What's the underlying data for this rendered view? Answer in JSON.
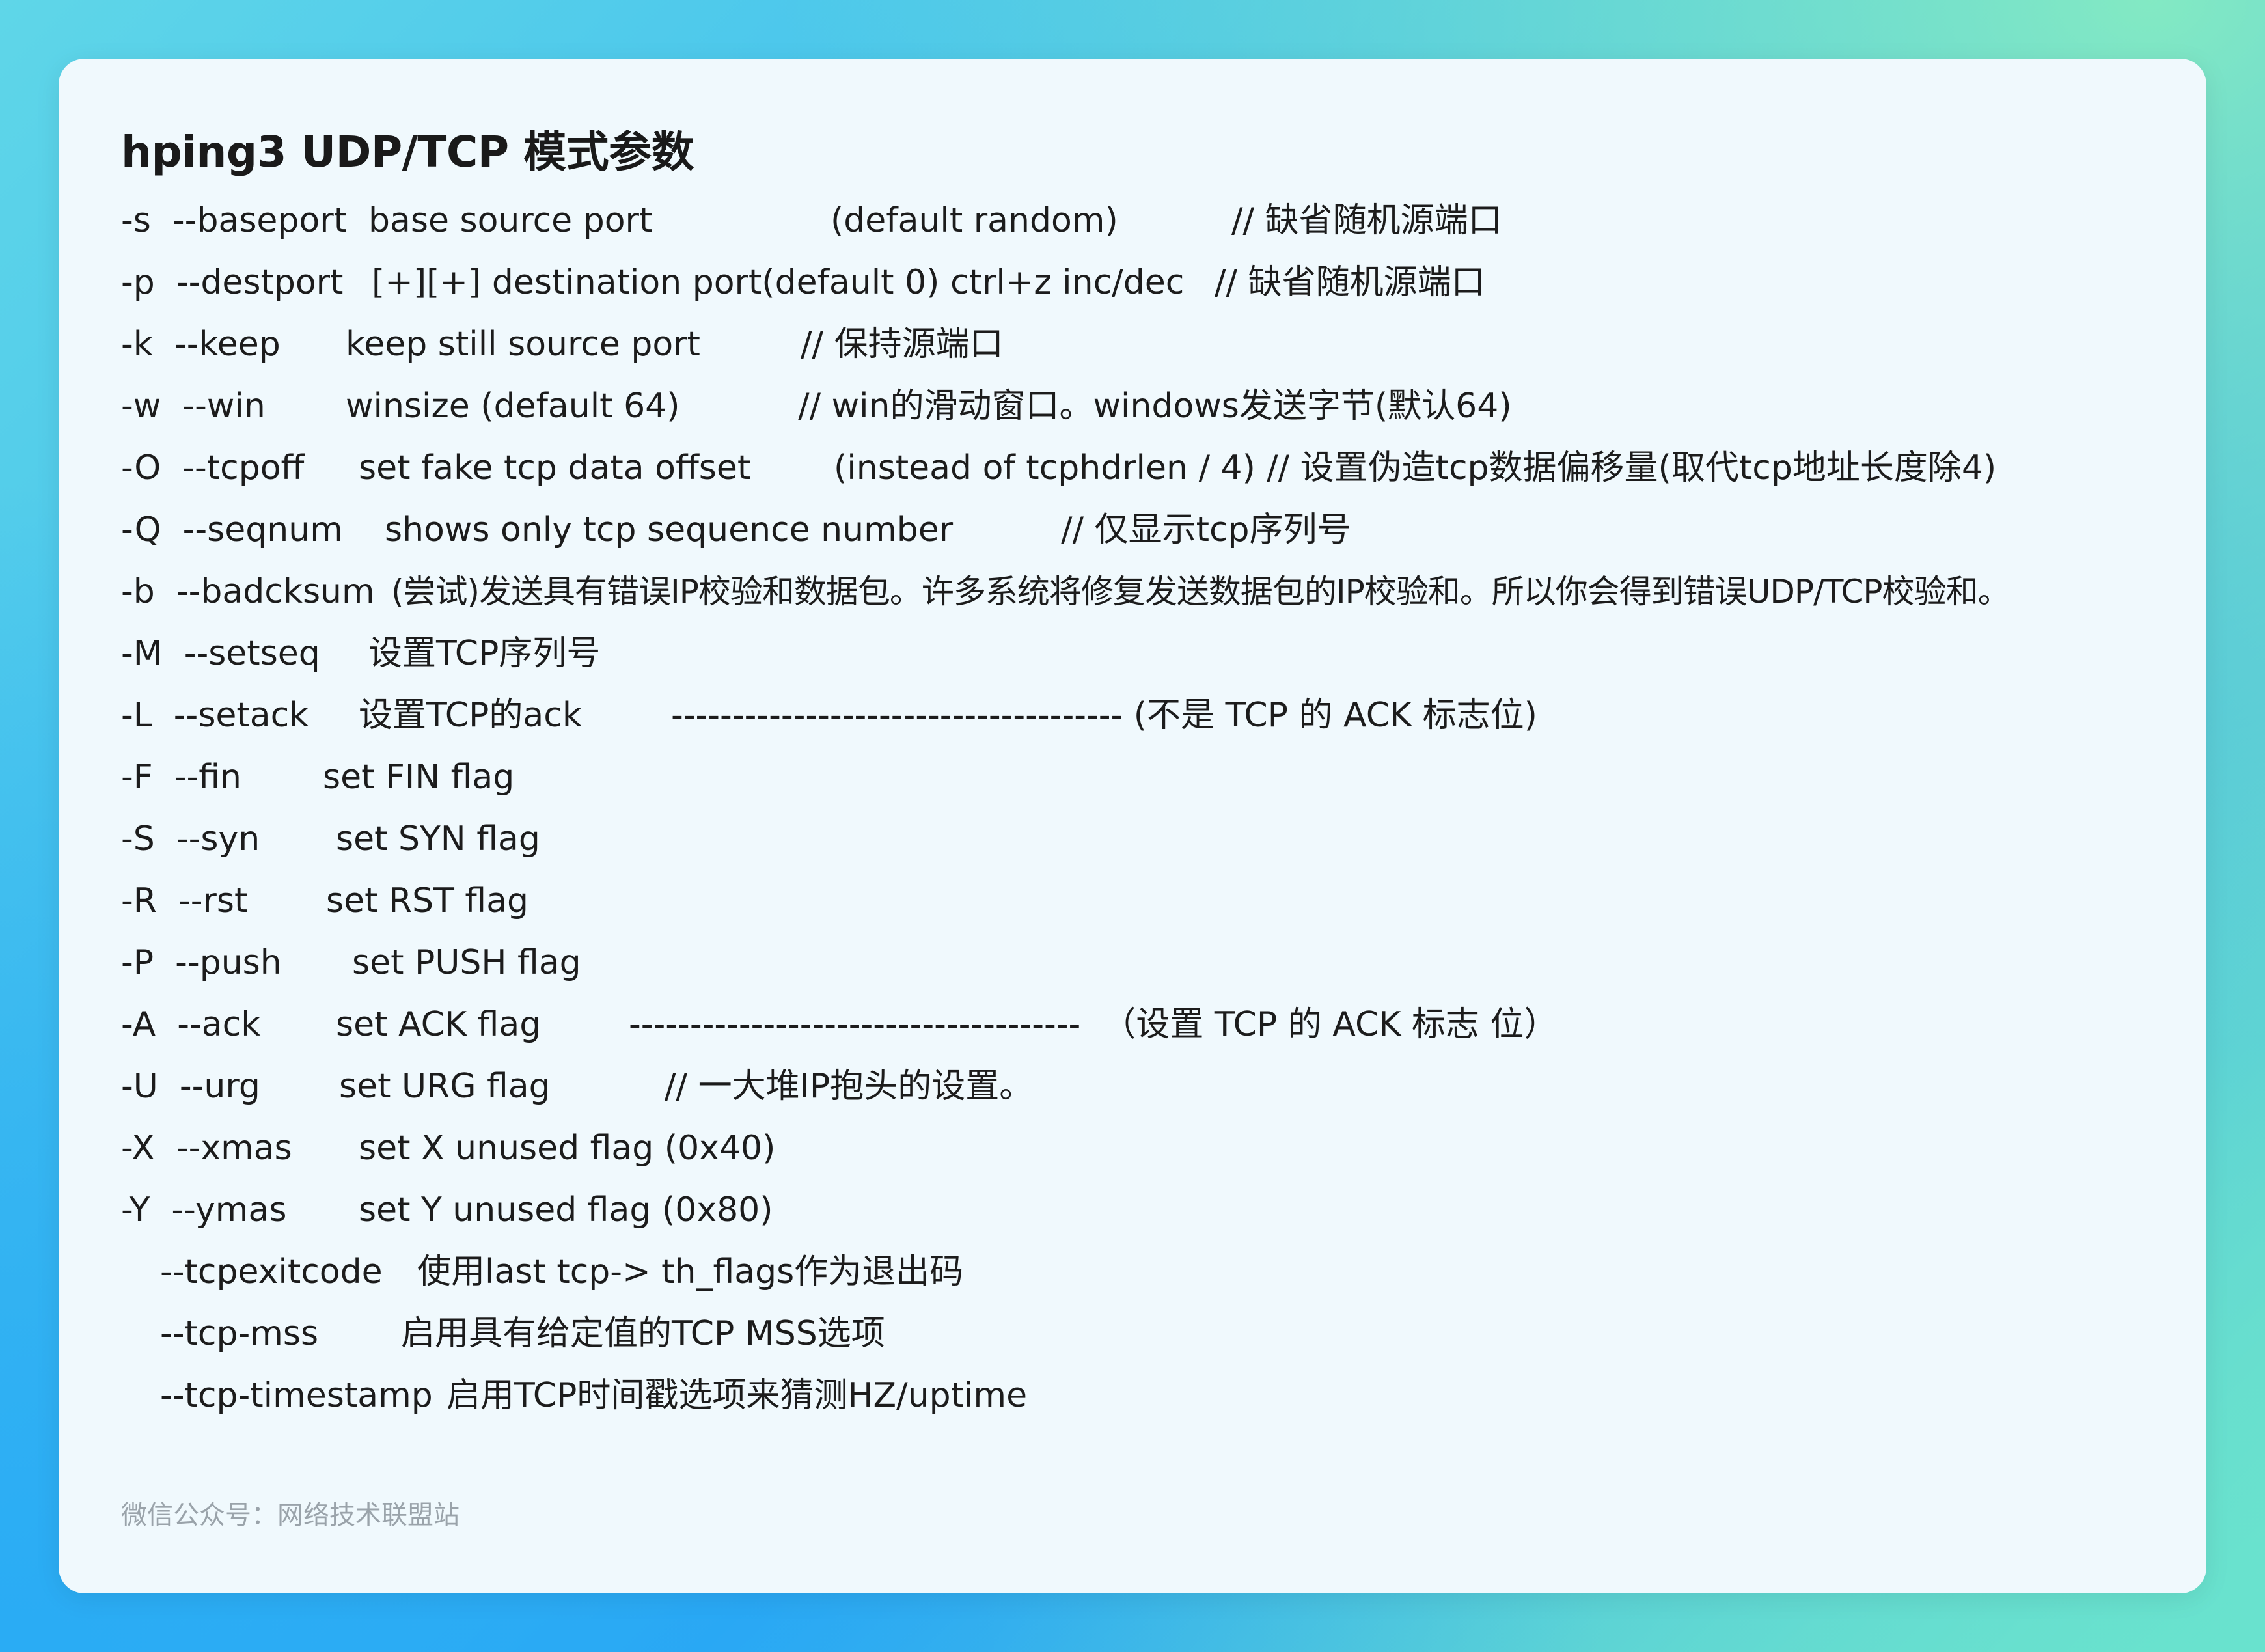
{
  "title": "hping3 UDP/TCP 模式参数",
  "footer": "微信公众号：网络技术联盟站",
  "lines": [
    {
      "flag": "-s  --baseport",
      "desc": "base source port",
      "extra": "(default random)",
      "comment": "// 缺省随机源端口"
    },
    {
      "flag": "-p  --destport",
      "desc": "[+][+] destination port(default 0) ctrl+z inc/dec",
      "comment": "// 缺省随机源端口"
    },
    {
      "flag": "-k  --keep",
      "desc": "keep still source port",
      "comment": "// 保持源端口"
    },
    {
      "flag": "-w  --win",
      "desc": "winsize (default 64)",
      "comment": "// win的滑动窗口。windows发送字节(默认64)"
    },
    {
      "flag": "-O  --tcpoff",
      "desc": "set fake tcp data offset",
      "extra": "(instead of tcphdrlen / 4)",
      "comment": "// 设置伪造tcp数据偏移量(取代tcp地址长度除4)"
    },
    {
      "flag": "-Q  --seqnum",
      "desc": "shows only tcp sequence number",
      "comment": "// 仅显示tcp序列号"
    },
    {
      "flag": "-b  --badcksum",
      "desc": "(尝试)发送具有错误IP校验和数据包。许多系统将修复发送数据包的IP校验和。所以你会得到错误UDP/TCP校验和。"
    },
    {
      "flag": "-M  --setseq",
      "desc": "设置TCP序列号"
    },
    {
      "flag": "-L  --setack",
      "desc": "设置TCP的ack",
      "comment": "------------------------------------- (不是 TCP 的 ACK 标志位)"
    },
    {
      "flag": "-F  --fin",
      "desc": "set FIN flag"
    },
    {
      "flag": "-S  --syn",
      "desc": "set SYN flag"
    },
    {
      "flag": "-R  --rst",
      "desc": "set RST flag"
    },
    {
      "flag": "-P  --push",
      "desc": "set PUSH flag"
    },
    {
      "flag": "-A  --ack",
      "desc": "set ACK flag",
      "comment": "-------------------------------------  （设置 TCP 的 ACK 标志 位）"
    },
    {
      "flag": "-U  --urg",
      "desc": "set URG flag",
      "comment": "// 一大堆IP抱头的设置。"
    },
    {
      "flag": "-X  --xmas",
      "desc": "set X unused flag (0x40)"
    },
    {
      "flag": "-Y  --ymas",
      "desc": "set Y unused flag (0x80)"
    },
    {
      "flag": "--tcpexitcode",
      "desc": "使用last tcp-> th_flags作为退出码"
    },
    {
      "flag": "--tcp-mss",
      "desc": "启用具有给定值的TCP MSS选项"
    },
    {
      "flag": "--tcp-timestamp",
      "desc": "启用TCP时间戳选项来猜测HZ/uptime"
    }
  ]
}
